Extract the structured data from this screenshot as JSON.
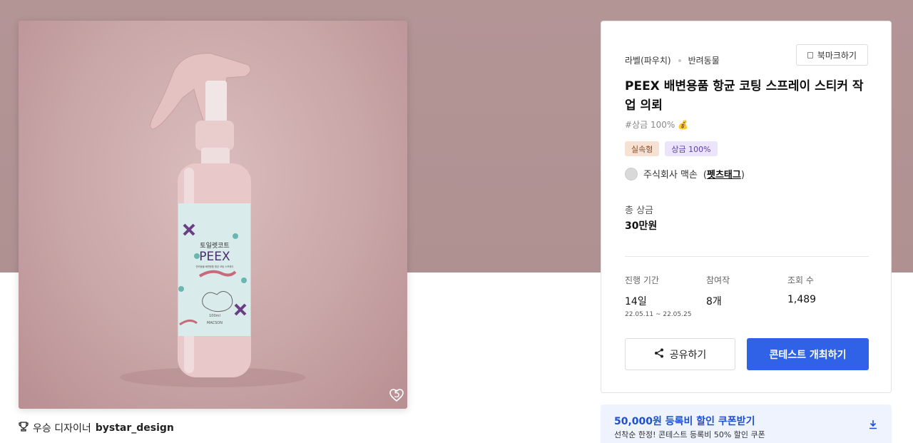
{
  "product": {
    "likes": "5",
    "label_brand_small": "토일렛코트",
    "label_brand_large": "PEEX",
    "label_line": "반려동물 배변용품 항균 코팅 스프레이",
    "label_volume": "100ml",
    "label_maker": "MACSON"
  },
  "winner": {
    "prefix": "우승 디자이너",
    "designer": "bystar_design"
  },
  "contest": {
    "category": "라벨(파우치)",
    "subcategory": "반려동물",
    "bookmark_label": "북마크하기",
    "title": "PEEX 배변용품 항균 코팅 스프레이 스티커 작업 의뢰",
    "tagline": "#상금 100% 💰",
    "badges": [
      "실속형",
      "상금 100%"
    ],
    "host_name": "주식회사 맥손",
    "host_link": "펫츠태그",
    "prize_label": "총 상금",
    "prize_value": "30만원",
    "stats": {
      "duration_label": "진행 기간",
      "duration_value": "14일",
      "duration_range": "22.05.11 ~ 22.05.25",
      "entries_label": "참여작",
      "entries_value": "8개",
      "views_label": "조회 수",
      "views_value": "1,489"
    },
    "share_label": "공유하기",
    "host_contest_label": "콘테스트 개최하기"
  },
  "coupon": {
    "title": "50,000원 등록비 할인 쿠폰받기",
    "subtitle": "선착순 한정! 콘테스트 등록비 50% 할인 쿠폰"
  },
  "colors": {
    "hero_bg": "#b49596",
    "primary": "#3062e8",
    "coupon_bg": "#eef3fd",
    "badge_practical_bg": "#f6e1d2",
    "badge_prize_bg": "#ece4fb"
  },
  "icons": [
    "heart-icon",
    "trophy-icon",
    "bookmark-icon",
    "share-icon",
    "download-icon"
  ]
}
